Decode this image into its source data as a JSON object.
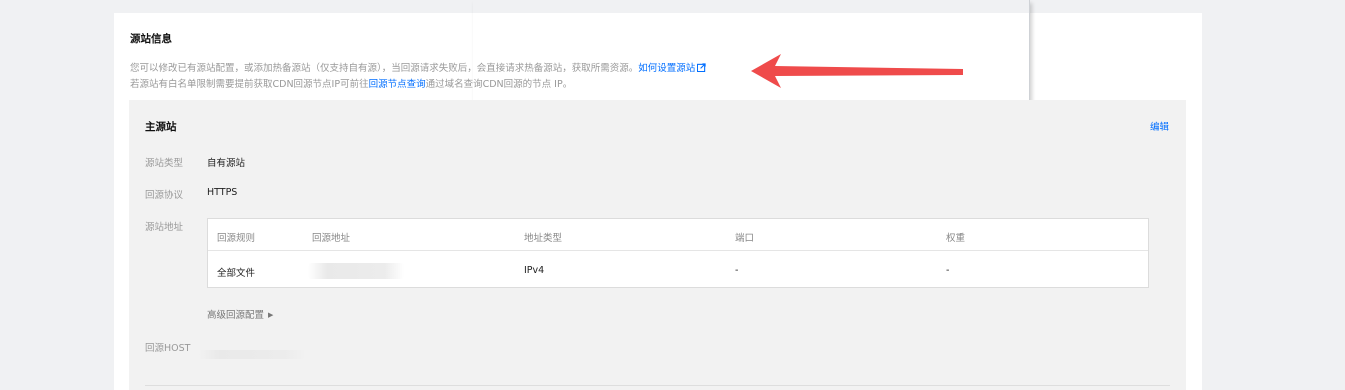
{
  "section": {
    "title": "源站信息",
    "desc_line1": "您可以修改已有源站配置，或添加热备源站（仅支持自有源），当回源请求失败后，会直接请求热备源站，获取所需资源。",
    "help_link": "如何设置源站",
    "desc_line2_prefix": "若源站有白名单限制需要提前获取CDN回源节点IP可前往",
    "desc_line2_link": "回源节点查询",
    "desc_line2_suffix": "通过域名查询CDN回源的节点 IP。"
  },
  "primary": {
    "title": "主源站",
    "edit": "编辑",
    "origin_type_label": "源站类型",
    "origin_type_value": "自有源站",
    "protocol_label": "回源协议",
    "protocol_value": "HTTPS",
    "address_label": "源站地址",
    "table": {
      "headers": [
        "回源规则",
        "回源地址",
        "地址类型",
        "端口",
        "权重"
      ],
      "rows": [
        {
          "rule": "全部文件",
          "address": "",
          "type": "IPv4",
          "port": "-",
          "weight": "-"
        }
      ]
    },
    "advanced": "高级回源配置",
    "host_label": "回源HOST"
  },
  "colors": {
    "link": "#006eff",
    "arrow": "#ef4b4b"
  }
}
